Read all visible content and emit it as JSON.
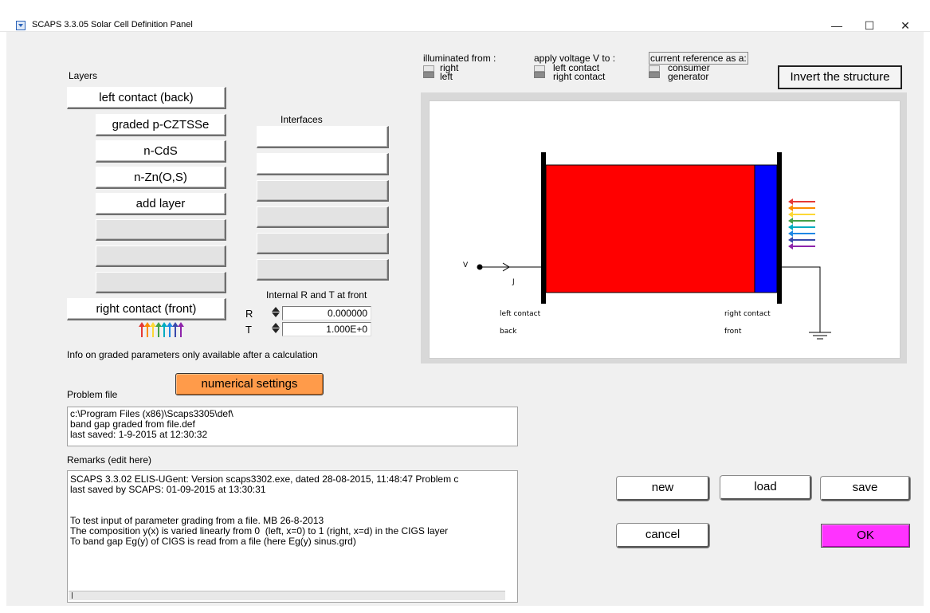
{
  "window": {
    "title": "SCAPS 3.3.05 Solar Cell Definition Panel",
    "minimize": "—",
    "maximize": "☐",
    "close": "✕"
  },
  "layers": {
    "heading": "Layers",
    "left_contact": "left contact (back)",
    "items": [
      "graded p-CZTSSe",
      "n-CdS",
      "n-Zn(O,S)"
    ],
    "add_layer": "add layer",
    "right_contact": "right contact (front)"
  },
  "interfaces": {
    "heading": "Interfaces"
  },
  "internal_rt": {
    "heading": "Internal R and T at front",
    "r_label": "R",
    "r_value": "0.000000",
    "t_label": "T",
    "t_value": "1.000E+0"
  },
  "info_text": "Info on graded parameters only available after a calculation",
  "numerical_settings": "numerical settings",
  "illuminated": {
    "label": "illuminated from :",
    "opt1": "right",
    "opt2": "left"
  },
  "apply_voltage": {
    "label": "apply voltage V to :",
    "opt1": "left contact",
    "opt2": "right contact"
  },
  "current_ref": {
    "label": "current reference as a:",
    "opt1": "consumer",
    "opt2": "generator"
  },
  "invert_button": "Invert the structure",
  "diagram": {
    "v_label": "V",
    "j_label": "J",
    "left_contact_label": "left contact",
    "back_label": "back",
    "right_contact_label": "right contact",
    "front_label": "front",
    "colors": {
      "absorber": "#ff0000",
      "window": "#0000ff",
      "light": [
        "#e53935",
        "#fb8c00",
        "#fdd835",
        "#43a047",
        "#00acc1",
        "#1e88e5",
        "#3949ab",
        "#8e24aa"
      ]
    }
  },
  "problem_file": {
    "label": "Problem file",
    "text": "c:\\Program Files (x86)\\Scaps3305\\def\\\nband gap graded from file.def\nlast saved: 1-9-2015 at 12:30:32"
  },
  "remarks": {
    "label": "Remarks (edit here)",
    "text": "SCAPS 3.3.02 ELIS-UGent: Version scaps3302.exe, dated 28-08-2015, 11:48:47 Problem c\nlast saved by SCAPS: 01-09-2015 at 13:30:31\n\n\nTo test input of parameter grading from a file. MB 26-8-2013\nThe composition y(x) is varied linearly from 0  (left, x=0) to 1 (right, x=d) in the CIGS layer\nTo band gap Eg(y) of CIGS is read from a file (here Eg(y) sinus.grd)"
  },
  "buttons": {
    "new": "new",
    "load": "load",
    "save": "save",
    "cancel": "cancel",
    "ok": "OK"
  },
  "accent_colors": {
    "numerical_settings": "#ff9b4a",
    "ok": "#ff33ff"
  }
}
